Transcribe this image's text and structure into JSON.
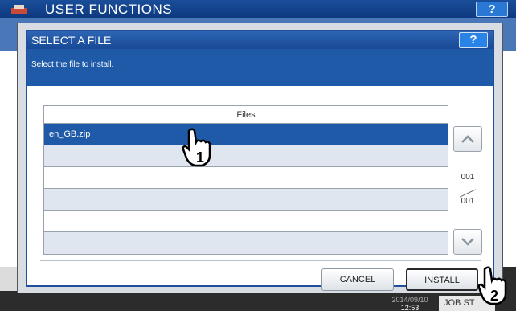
{
  "background": {
    "title": "USER FUNCTIONS",
    "help_label": "?",
    "clock_line1": "2014/09/10",
    "clock_line2": "12:53",
    "job_status_label": "JOB ST"
  },
  "dialog": {
    "title": "SELECT A FILE",
    "help_label": "?",
    "message": "Select the file to install.",
    "table": {
      "header": "Files",
      "rows": [
        "en_GB.zip",
        "",
        "",
        "",
        "",
        ""
      ]
    },
    "pager": {
      "current": "001",
      "total": "001"
    },
    "cancel_label": "CANCEL",
    "install_label": "INSTALL"
  },
  "callouts": {
    "step1": "1",
    "step2": "2"
  },
  "icons": {
    "up": "chevron-up-icon",
    "down": "chevron-down-icon",
    "hand": "pointing-hand-icon"
  },
  "colors": {
    "header_blue": "#184a95",
    "selected_row": "#1f5aa8",
    "alt_row": "#dfe6ef"
  }
}
